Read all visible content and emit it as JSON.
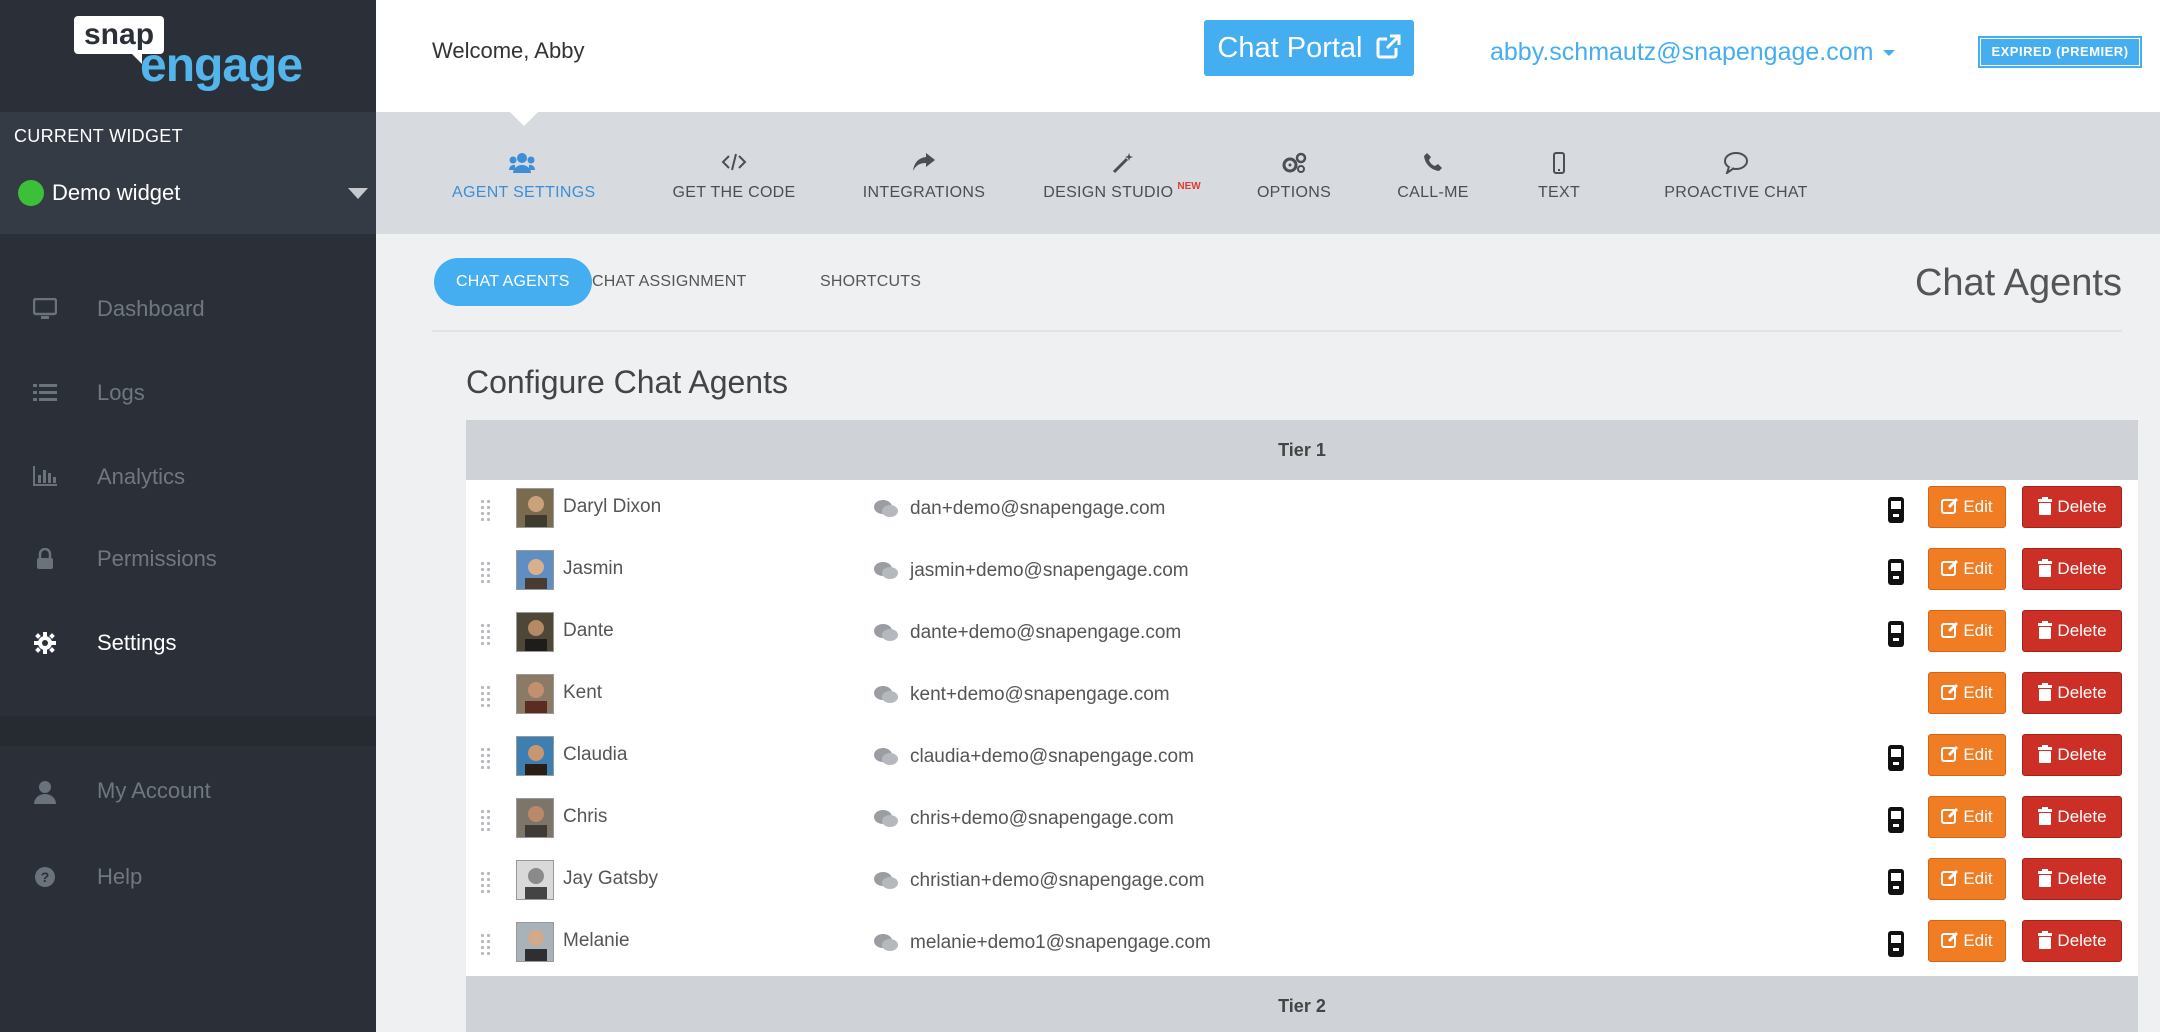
{
  "brand": {
    "logo_top": "snap",
    "logo_bottom": "engage"
  },
  "sidebar": {
    "widget_label": "CURRENT WIDGET",
    "widget_name": "Demo widget",
    "widget_status_color": "#3dbf3a",
    "items": [
      {
        "label": "Dashboard",
        "icon": "monitor-icon"
      },
      {
        "label": "Logs",
        "icon": "list-icon"
      },
      {
        "label": "Analytics",
        "icon": "bar-chart-icon"
      },
      {
        "label": "Permissions",
        "icon": "lock-icon"
      },
      {
        "label": "Settings",
        "icon": "gear-icon",
        "active": true
      },
      {
        "label": "My Account",
        "icon": "user-icon"
      },
      {
        "label": "Help",
        "icon": "help-icon"
      }
    ]
  },
  "header": {
    "welcome": "Welcome, Abby",
    "portal_button": "Chat Portal",
    "user_email": "abby.schmautz@snapengage.com",
    "plan_badge": "EXPIRED (PREMIER)"
  },
  "settings_nav": {
    "items": [
      {
        "label": "AGENT SETTINGS",
        "icon": "users-icon",
        "active": true
      },
      {
        "label": "GET THE CODE",
        "icon": "code-icon"
      },
      {
        "label": "INTEGRATIONS",
        "icon": "share-icon"
      },
      {
        "label": "DESIGN STUDIO",
        "icon": "magic-wand-icon",
        "badge": "NEW"
      },
      {
        "label": "OPTIONS",
        "icon": "cogs-icon"
      },
      {
        "label": "CALL-ME",
        "icon": "phone-icon"
      },
      {
        "label": "TEXT",
        "icon": "mobile-icon"
      },
      {
        "label": "PROACTIVE CHAT",
        "icon": "speech-bubble-icon"
      }
    ]
  },
  "tabs": [
    {
      "label": "CHAT AGENTS",
      "active": true
    },
    {
      "label": "CHAT ASSIGNMENT"
    },
    {
      "label": "SHORTCUTS"
    }
  ],
  "section_title": "Chat Agents",
  "config_title": "Configure Chat Agents",
  "tiers": [
    {
      "label": "Tier 1"
    },
    {
      "label": "Tier 2"
    }
  ],
  "agents": [
    {
      "name": "Daryl Dixon",
      "email": "dan+demo@snapengage.com",
      "mobile": true
    },
    {
      "name": "Jasmin",
      "email": "jasmin+demo@snapengage.com",
      "mobile": true
    },
    {
      "name": "Dante",
      "email": "dante+demo@snapengage.com",
      "mobile": true
    },
    {
      "name": "Kent",
      "email": "kent+demo@snapengage.com",
      "mobile": false
    },
    {
      "name": "Claudia",
      "email": "claudia+demo@snapengage.com",
      "mobile": true
    },
    {
      "name": "Chris",
      "email": "chris+demo@snapengage.com",
      "mobile": true
    },
    {
      "name": "Jay Gatsby",
      "email": "christian+demo@snapengage.com",
      "mobile": true
    },
    {
      "name": "Melanie",
      "email": "melanie+demo1@snapengage.com",
      "mobile": true
    }
  ],
  "actions": {
    "edit": "Edit",
    "delete": "Delete"
  },
  "colors": {
    "accent": "#44aef0",
    "edit": "#f07c24",
    "delete": "#cc2f25",
    "sidebar": "#2b3038"
  }
}
